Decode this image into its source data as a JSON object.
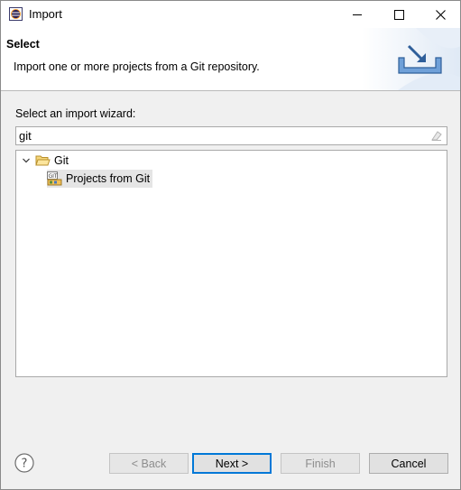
{
  "window": {
    "title": "Import",
    "controls": {
      "minimize": "minimize",
      "maximize": "maximize",
      "close": "close"
    }
  },
  "header": {
    "title": "Select",
    "description": "Import one or more projects from a Git repository."
  },
  "wizard": {
    "label": "Select an import wizard:",
    "filter_value": "git",
    "tree": {
      "category": "Git",
      "category_expanded": true,
      "items": [
        {
          "label": "Projects from Git",
          "selected": true
        }
      ]
    }
  },
  "buttons": {
    "back": "< Back",
    "next": "Next >",
    "finish": "Finish",
    "cancel": "Cancel"
  },
  "icons": {
    "app": "eclipse-icon",
    "help": "help-icon",
    "clear": "clear-filter-icon",
    "folder": "folder-open-icon",
    "item": "git-projects-icon",
    "banner": "import-banner-icon"
  },
  "colors": {
    "default_button_border": "#0078d7",
    "selection": "#e5e5e5",
    "banner_accent": "#4a86c8"
  }
}
